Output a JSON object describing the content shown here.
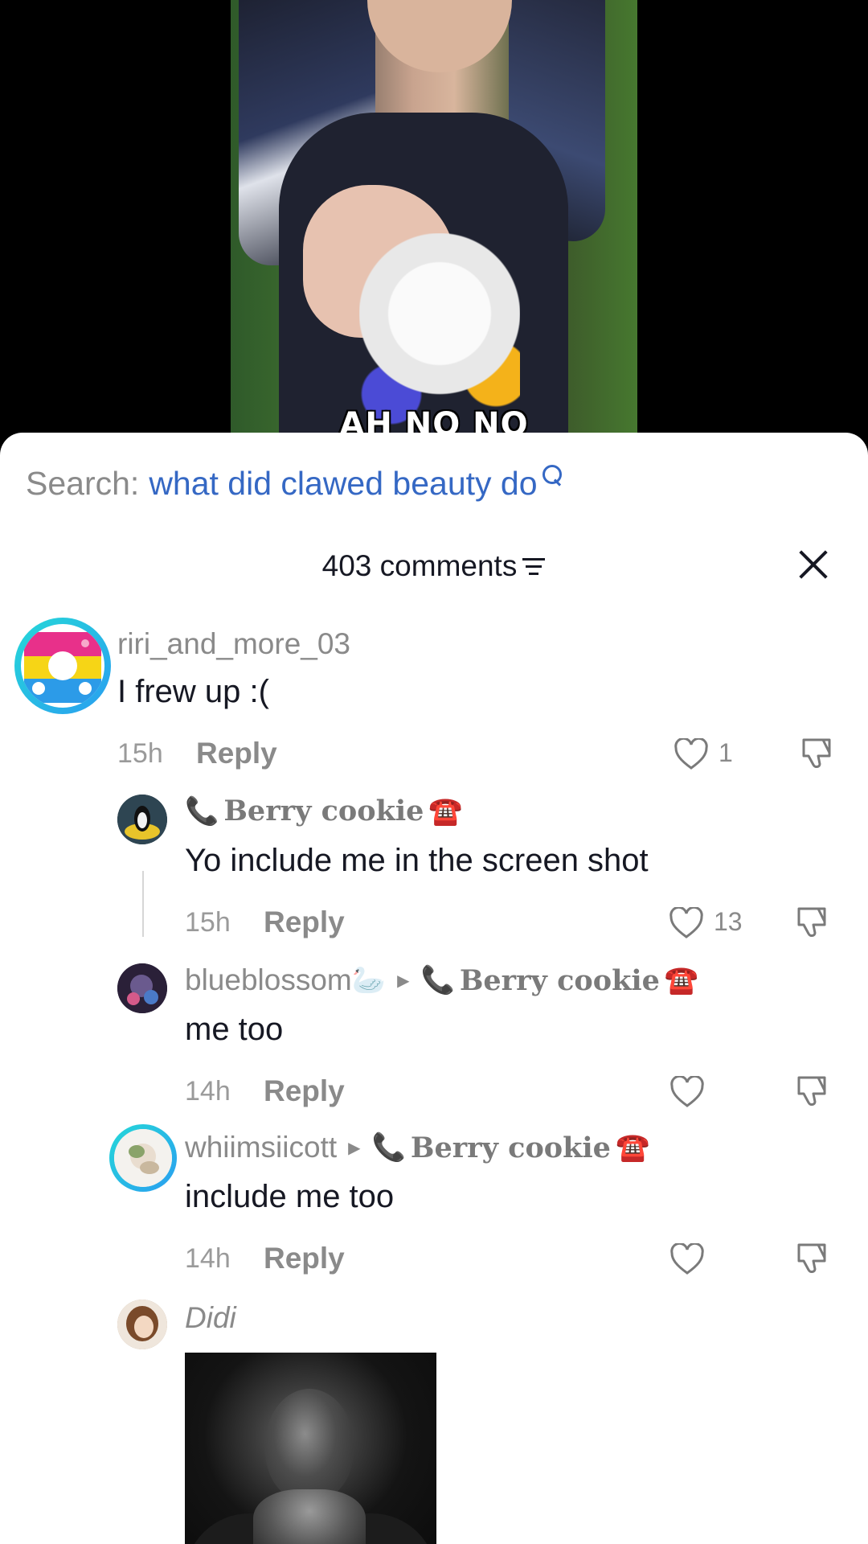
{
  "video": {
    "caption": "AH NO NO"
  },
  "search": {
    "prefix": "Search:",
    "query": "what did clawed beauty do"
  },
  "comments_header": {
    "count_label": "403 comments"
  },
  "comments": [
    {
      "username": "riri_and_more_03",
      "text": "I frew up :(",
      "time": "15h",
      "reply_label": "Reply",
      "likes": "1"
    },
    {
      "username_prefix_emoji": "📞",
      "username": "Berry cookie",
      "username_suffix_emoji": "☎️",
      "text": "Yo include me in the screen shot",
      "time": "15h",
      "reply_label": "Reply",
      "likes": "13"
    },
    {
      "username": "blueblossom",
      "username_emoji": "🦢",
      "reply_to_prefix_emoji": "📞",
      "reply_to": "Berry cookie",
      "reply_to_suffix_emoji": "☎️",
      "text": "me too",
      "time": "14h",
      "reply_label": "Reply",
      "likes": ""
    },
    {
      "username": "whiimsiicott",
      "reply_to_prefix_emoji": "📞",
      "reply_to": "Berry cookie",
      "reply_to_suffix_emoji": "☎️",
      "text": "include me too",
      "time": "14h",
      "reply_label": "Reply",
      "likes": ""
    },
    {
      "username": "Didi"
    }
  ],
  "icons": {
    "search": "search-icon",
    "sort": "sort-icon",
    "close": "close-icon",
    "like": "heart-icon",
    "dislike": "thumbs-down-icon"
  },
  "colors": {
    "search_query": "#3568c4",
    "muted": "#8a8a8a",
    "avatar_ring": "#25d8d8"
  }
}
